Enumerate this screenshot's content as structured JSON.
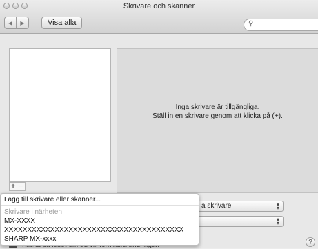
{
  "window": {
    "title": "Skrivare och skanner"
  },
  "toolbar": {
    "show_all": "Visa alla",
    "search_placeholder": ""
  },
  "detail": {
    "line1": "Inga skrivare är tillgängliga.",
    "line2": "Ställ in en skrivare genom att klicka på (+)."
  },
  "buttons": {
    "add": "+",
    "remove": "−",
    "help": "?"
  },
  "popups": {
    "default_printer_partial": "a skrivare"
  },
  "lock": {
    "text": "Klicka på låset om du vill förhindra ändringar."
  },
  "menu": {
    "add_item": "Lägg till skrivare eller skanner...",
    "section_header": "Skrivare i närheten",
    "items": [
      "MX-XXXX",
      "XXXXXXXXXXXXXXXXXXXXXXXXXXXXXXXXXXXXXXX",
      "SHARP MX-xxxx"
    ]
  }
}
